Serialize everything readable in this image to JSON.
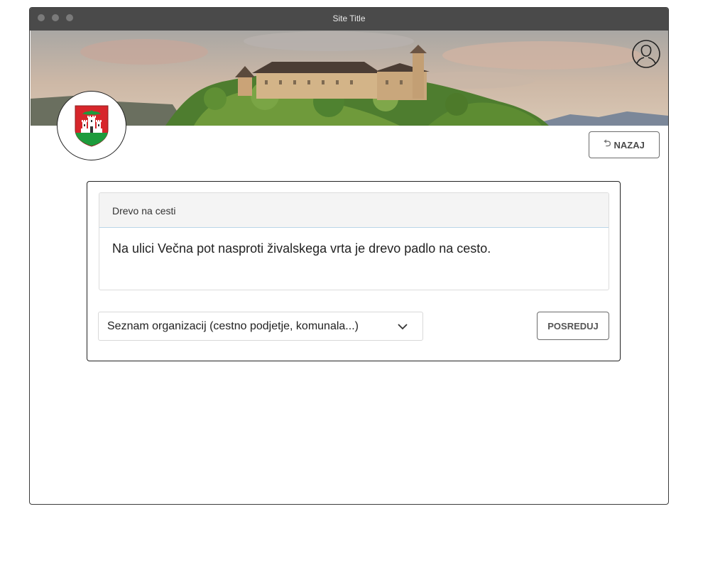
{
  "window": {
    "title": "Site Title"
  },
  "header": {
    "user_icon": "user-profile-icon",
    "crest_icon": "city-crest-icon"
  },
  "toolbar": {
    "back_label": "NAZAJ",
    "back_icon": "reply-arrow-icon"
  },
  "report": {
    "title": "Drevo na cesti",
    "description": "Na ulici Večna pot nasproti živalskega vrta je drevo padlo na cesto."
  },
  "forward": {
    "select_value": "Seznam organizacij (cestno podjetje, komunala...)",
    "select_icon": "chevron-down-icon",
    "button_label": "POSREDUJ"
  },
  "colors": {
    "crest_red": "#d7262b",
    "crest_green": "#1e9b3c",
    "titlebar": "#4a4a4a"
  }
}
